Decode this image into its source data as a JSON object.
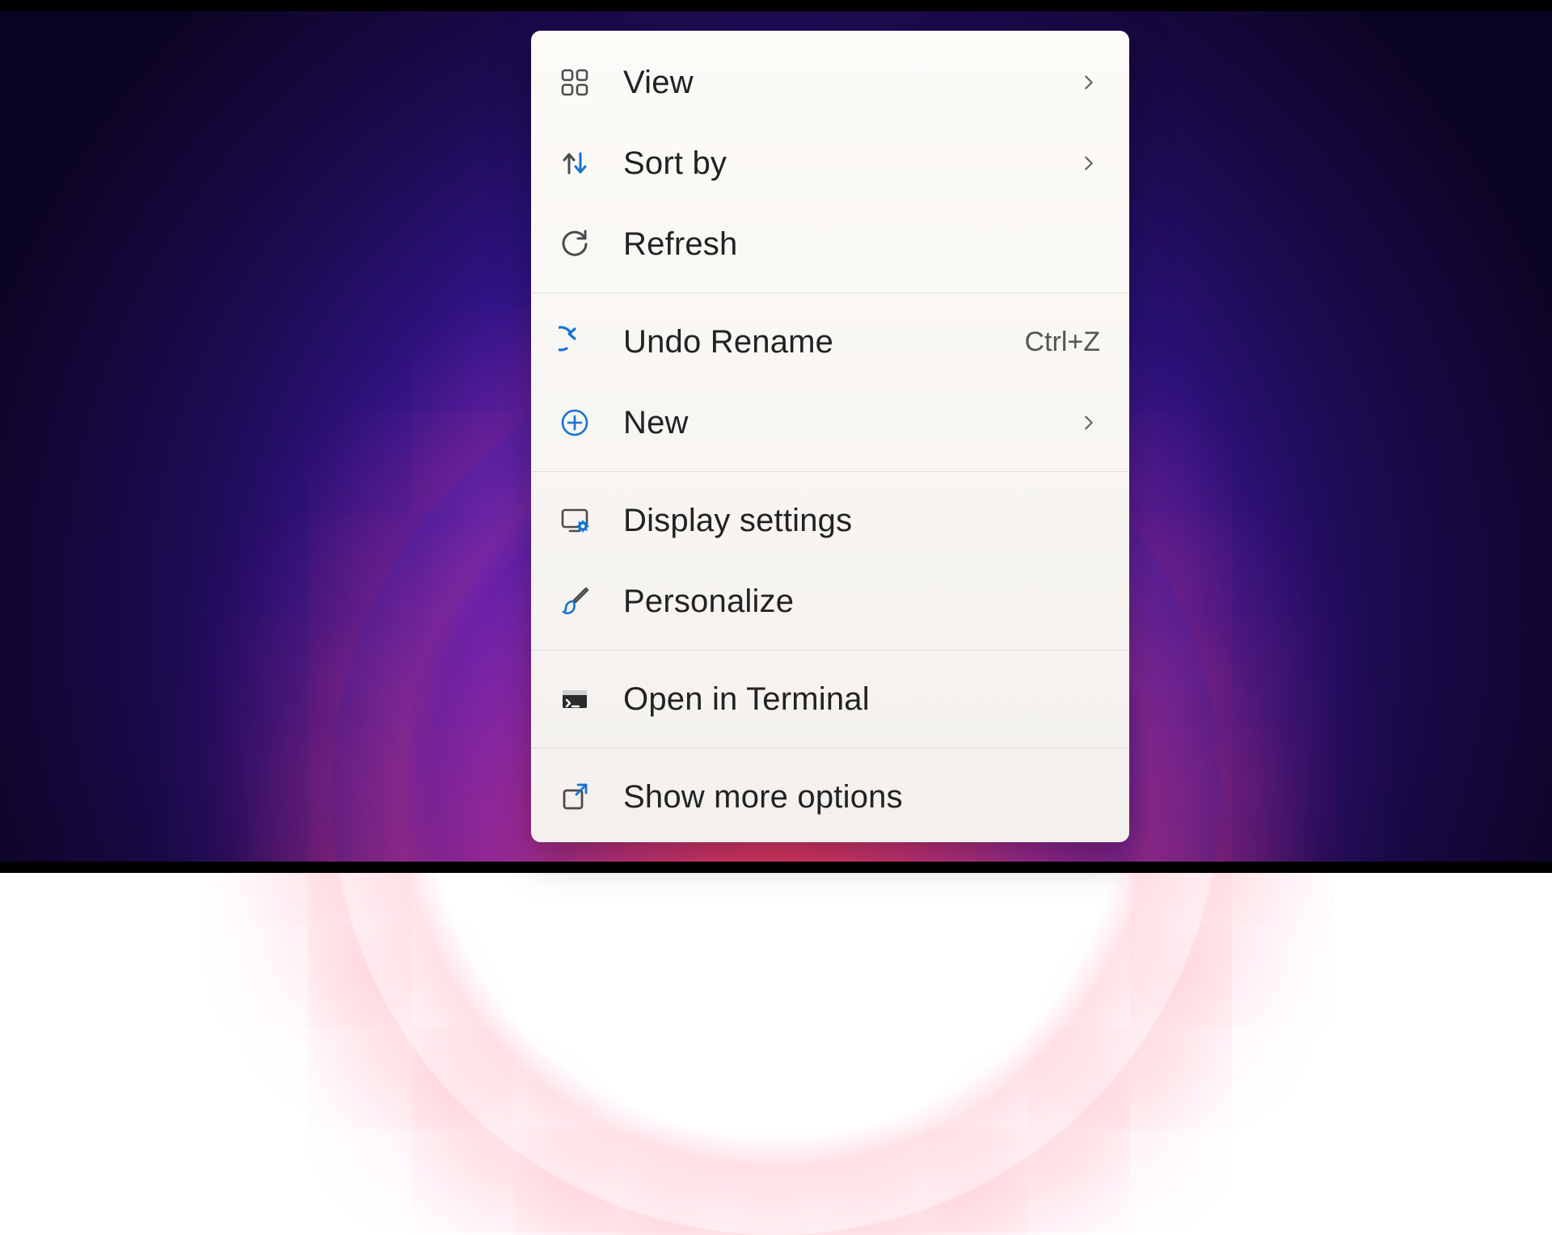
{
  "menu": {
    "groups": [
      [
        {
          "id": "view",
          "label": "View",
          "icon": "grid",
          "submenu": true
        },
        {
          "id": "sortby",
          "label": "Sort by",
          "icon": "sort",
          "submenu": true
        },
        {
          "id": "refresh",
          "label": "Refresh",
          "icon": "refresh"
        }
      ],
      [
        {
          "id": "undo",
          "label": "Undo Rename",
          "icon": "undo",
          "shortcut": "Ctrl+Z"
        },
        {
          "id": "new",
          "label": "New",
          "icon": "plus",
          "submenu": true
        }
      ],
      [
        {
          "id": "display",
          "label": "Display settings",
          "icon": "display"
        },
        {
          "id": "perso",
          "label": "Personalize",
          "icon": "brush"
        }
      ],
      [
        {
          "id": "terminal",
          "label": "Open in Terminal",
          "icon": "terminal"
        }
      ],
      [
        {
          "id": "more",
          "label": "Show more options",
          "icon": "expand"
        }
      ]
    ]
  }
}
